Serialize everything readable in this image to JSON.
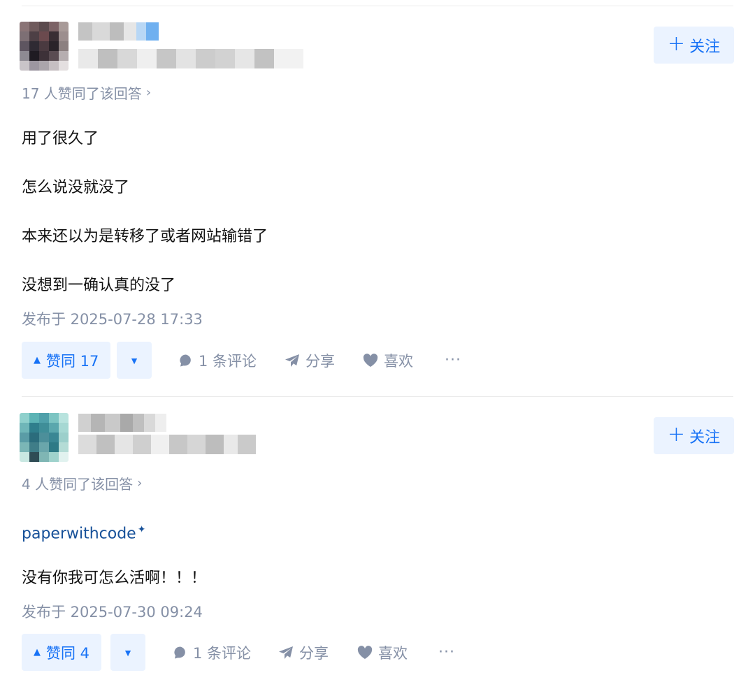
{
  "answers": [
    {
      "follow_label": "关注",
      "voters_text": "17 人赞同了该回答",
      "paragraphs": [
        "用了很久了",
        "怎么说没就没了",
        "本来还以为是转移了或者网站输错了",
        "没想到一确认真的没了"
      ],
      "published": "发布于 2025-07-28 17:33",
      "upvote_label": "赞同 17",
      "comment_label": "1 条评论",
      "share_label": "分享",
      "like_label": "喜欢",
      "more_label": "···"
    },
    {
      "follow_label": "关注",
      "voters_text": "4 人赞同了该回答",
      "link_text": "paperwithcode",
      "paragraphs": [
        "没有你我可怎么活啊！！！"
      ],
      "published": "发布于 2025-07-30 09:24",
      "upvote_label": "赞同 4",
      "comment_label": "1 条评论",
      "share_label": "分享",
      "like_label": "喜欢",
      "more_label": "···"
    }
  ],
  "colors": {
    "accent": "#1772f6",
    "accent_bg": "#ebf3ff",
    "meta_text": "#8590a6",
    "link": "#175199",
    "divider": "#ebebeb"
  },
  "icons": [
    "plus-icon",
    "chevron-right-icon",
    "triangle-up-icon",
    "triangle-down-icon",
    "comment-bubble-icon",
    "paper-plane-icon",
    "heart-icon",
    "ellipsis-icon"
  ]
}
